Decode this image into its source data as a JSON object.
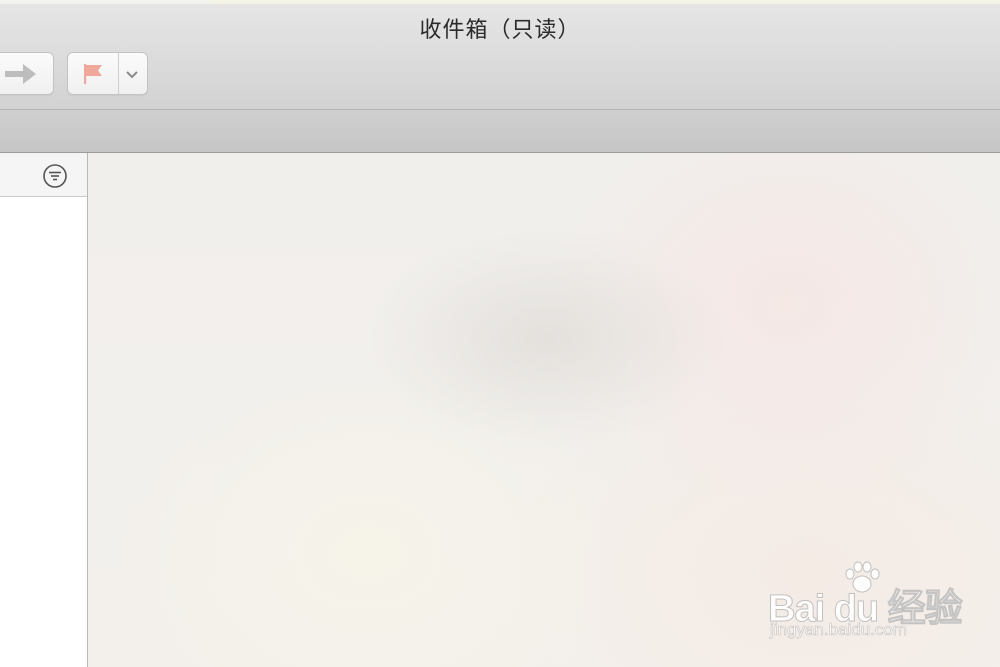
{
  "window": {
    "title": "收件箱（只读）"
  },
  "toolbar": {
    "forward_icon": "forward-arrow-icon",
    "flag_icon": "flag-icon",
    "flag_color": "#f0a89c",
    "flag_menu_icon": "chevron-down-icon"
  },
  "message_list": {
    "filter_icon": "filter-icon"
  },
  "watermark": {
    "brand": "Bai  du 经验",
    "url": "jingyan.baidu.com"
  }
}
